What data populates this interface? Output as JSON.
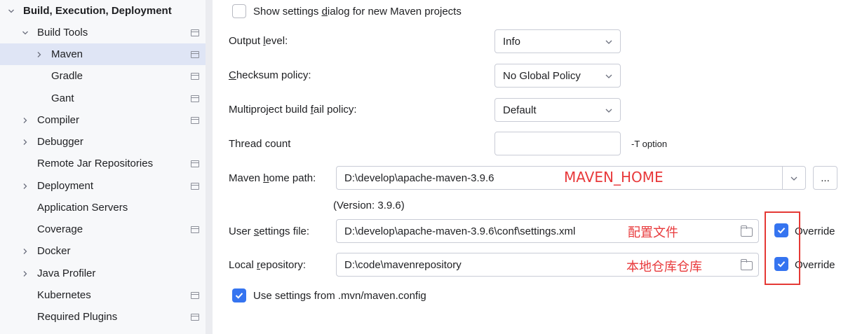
{
  "sidebar": {
    "section_title": "Build, Execution, Deployment",
    "items": [
      {
        "label": "Build Tools"
      },
      {
        "label": "Maven"
      },
      {
        "label": "Gradle"
      },
      {
        "label": "Gant"
      },
      {
        "label": "Compiler"
      },
      {
        "label": "Debugger"
      },
      {
        "label": "Remote Jar Repositories"
      },
      {
        "label": "Deployment"
      },
      {
        "label": "Application Servers"
      },
      {
        "label": "Coverage"
      },
      {
        "label": "Docker"
      },
      {
        "label": "Java Profiler"
      },
      {
        "label": "Kubernetes"
      },
      {
        "label": "Required Plugins"
      }
    ]
  },
  "settings": {
    "show_dialog_pre": "Show settings ",
    "show_dialog_mnemonic": "d",
    "show_dialog_post": "ialog for new Maven projects",
    "output_level_pre": "Output ",
    "output_level_mnemonic": "l",
    "output_level_post": "evel:",
    "output_level_value": "Info",
    "checksum_mnemonic": "C",
    "checksum_post": "hecksum policy:",
    "checksum_value": "No Global Policy",
    "multiproject_pre": "Multiproject build ",
    "multiproject_mnemonic": "f",
    "multiproject_post": "ail policy:",
    "multiproject_value": "Default",
    "thread_count_label": "Thread count",
    "thread_count_value": "",
    "thread_count_hint": "-T option",
    "home_path_pre": "Maven ",
    "home_path_mnemonic": "h",
    "home_path_post": "ome path:",
    "home_path_value": "D:\\develop\\apache-maven-3.9.6",
    "browse_label": "...",
    "version_text": "(Version: 3.9.6)",
    "user_settings_pre": "User ",
    "user_settings_mnemonic": "s",
    "user_settings_post": "ettings file:",
    "user_settings_value": "D:\\develop\\apache-maven-3.9.6\\conf\\settings.xml",
    "user_settings_override": "Override",
    "user_settings_override_checked": true,
    "local_repo_pre": "Local ",
    "local_repo_mnemonic": "r",
    "local_repo_post": "epository:",
    "local_repo_value": "D:\\code\\mavenrepository",
    "local_repo_override": "Override",
    "local_repo_override_checked": true,
    "use_mvn_config_label": "Use settings from .mvn/maven.config",
    "use_mvn_config_checked": true,
    "show_dialog_checked": false
  },
  "annotations": {
    "maven_home": "MAVEN_HOME",
    "config_file": "配置文件",
    "local_repo": "本地仓库仓库",
    "color": "#e8393b"
  },
  "theme": {
    "accent": "#3574f0",
    "selection": "#dfe5f5"
  }
}
